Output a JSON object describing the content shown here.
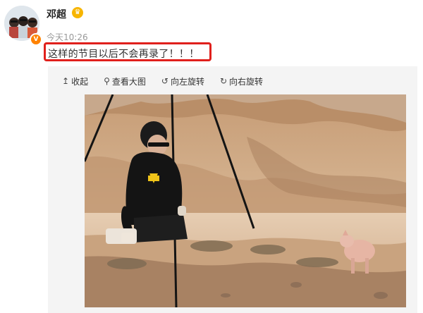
{
  "user": {
    "name": "邓超",
    "badge_icon": "crown-badge-icon",
    "verified_icon": "verified-v-icon",
    "verified_mark": "V",
    "timestamp": "今天10:26"
  },
  "post": {
    "text": "这样的节目以后不会再录了！！！",
    "highlight_color": "#e0201c"
  },
  "toolbar": {
    "items": [
      {
        "icon": "collapse-arrow-icon",
        "glyph": "↥",
        "label": "收起"
      },
      {
        "icon": "magnifier-icon",
        "glyph": "⚲",
        "label": "查看大图"
      },
      {
        "icon": "rotate-left-icon",
        "glyph": "↺",
        "label": "向左旋转"
      },
      {
        "icon": "rotate-right-icon",
        "glyph": "↻",
        "label": "向右旋转"
      }
    ]
  },
  "colors": {
    "accent": "#ff8200",
    "badge": "#f7b500",
    "text": "#333333",
    "muted": "#999999"
  }
}
